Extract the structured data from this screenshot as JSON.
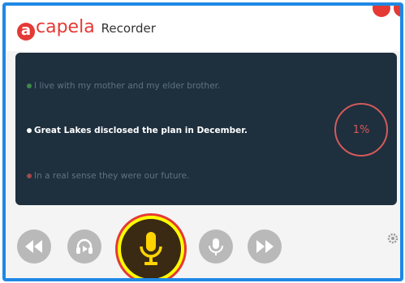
{
  "app": {
    "logo_mark": "a",
    "logo_word": "capela",
    "title": "Recorder"
  },
  "sentences": [
    {
      "text": "I live with my mother and my elder brother.",
      "state": "done"
    },
    {
      "text": "Great Lakes disclosed the plan in December.",
      "state": "current"
    },
    {
      "text": "In a real sense they were our future.",
      "state": "next"
    }
  ],
  "progress": {
    "label": "1%",
    "value": 0.01
  },
  "controls": {
    "icons": [
      "rewind-icon",
      "listen-icon",
      "microphone-icon",
      "play-recording-icon",
      "forward-icon",
      "settings-icon"
    ]
  },
  "colors": {
    "brand": "#e53935",
    "panel": "#1e2f3e",
    "frame": "#1e88e5",
    "mic_highlight": "#ffff00"
  }
}
